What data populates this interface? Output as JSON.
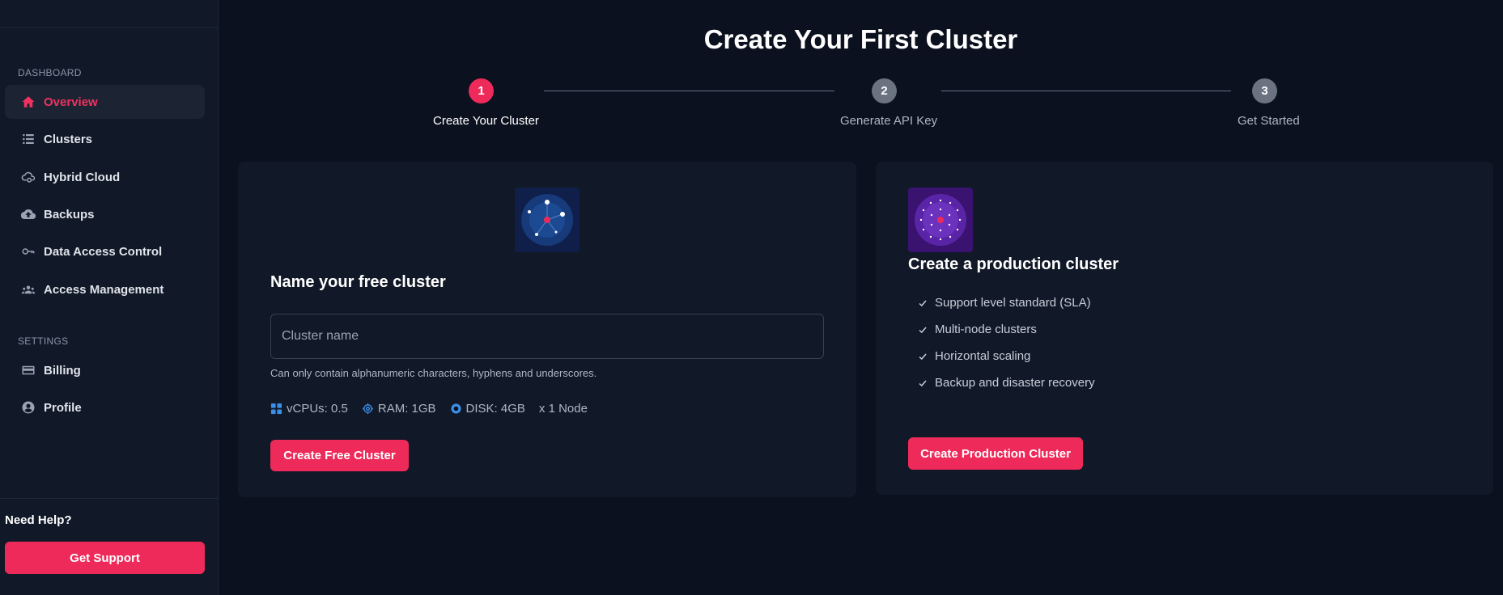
{
  "sidebar": {
    "dashboard_label": "DASHBOARD",
    "items": [
      {
        "label": "Overview",
        "icon": "home-icon"
      },
      {
        "label": "Clusters",
        "icon": "list-icon"
      },
      {
        "label": "Hybrid Cloud",
        "icon": "cloud-cog-icon"
      },
      {
        "label": "Backups",
        "icon": "cloud-upload-icon"
      },
      {
        "label": "Data Access Control",
        "icon": "key-icon"
      },
      {
        "label": "Access Management",
        "icon": "users-icon"
      }
    ],
    "settings_label": "SETTINGS",
    "settings_items": [
      {
        "label": "Billing",
        "icon": "credit-card-icon"
      },
      {
        "label": "Profile",
        "icon": "user-circle-icon"
      }
    ],
    "help_label": "Need Help?",
    "support_button": "Get Support"
  },
  "page": {
    "title": "Create Your First Cluster"
  },
  "steps": [
    {
      "number": "1",
      "label": "Create Your Cluster",
      "state": "active"
    },
    {
      "number": "2",
      "label": "Generate API Key",
      "state": "pending"
    },
    {
      "number": "3",
      "label": "Get Started",
      "state": "pending"
    }
  ],
  "free_cluster": {
    "title": "Name your free cluster",
    "input_placeholder": "Cluster name",
    "input_value": "",
    "hint": "Can only contain alphanumeric characters, hyphens and underscores.",
    "specs": {
      "vcpu": "vCPUs: 0.5",
      "ram": "RAM: 1GB",
      "disk": "DISK: 4GB",
      "nodes": "x 1 Node"
    },
    "button": "Create Free Cluster"
  },
  "production_cluster": {
    "title": "Create a production cluster",
    "features": [
      "Support level standard (SLA)",
      "Multi-node clusters",
      "Horizontal scaling",
      "Backup and disaster recovery"
    ],
    "button": "Create Production Cluster"
  },
  "colors": {
    "accent": "#ee2a5a",
    "background": "#0b111e",
    "card": "#111827",
    "spec_icon": "#3b8fe8"
  }
}
